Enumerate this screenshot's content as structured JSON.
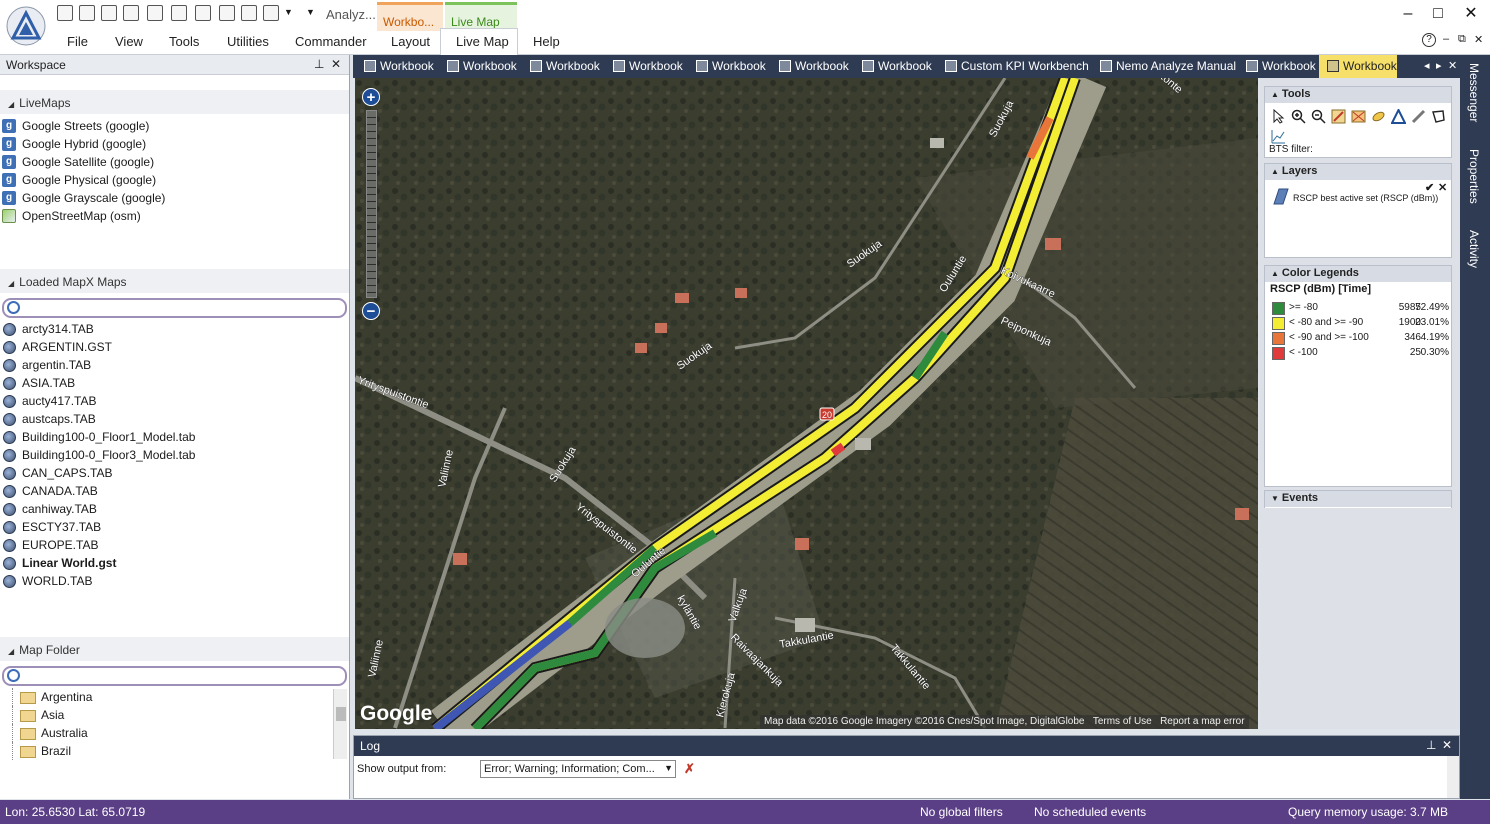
{
  "ribbon": {
    "search_label": "Analyz...",
    "context_tabs": [
      "Workbo...",
      "Live Map"
    ],
    "menu": [
      "File",
      "View",
      "Tools",
      "Utilities",
      "Commander",
      "Layout",
      "Live Map",
      "Help"
    ],
    "window_controls": [
      "–",
      "□",
      "✕"
    ],
    "help_icon": "?",
    "sub_controls": [
      "–",
      "⧉",
      "✕"
    ]
  },
  "workspace": {
    "title": "Workspace",
    "pin": "⊥",
    "close": "✕",
    "livemaps": {
      "heading": "LiveMaps",
      "items": [
        "Google Streets (google)",
        "Google Hybrid (google)",
        "Google Satellite (google)",
        "Google Physical (google)",
        "Google Grayscale (google)",
        "OpenStreetMap (osm)"
      ]
    },
    "mapx": {
      "heading": "Loaded MapX Maps",
      "items": [
        "arcty314.TAB",
        "ARGENTIN.GST",
        "argentin.TAB",
        "ASIA.TAB",
        "aucty417.TAB",
        "austcaps.TAB",
        "Building100-0_Floor1_Model.tab",
        "Building100-0_Floor3_Model.tab",
        "CAN_CAPS.TAB",
        "CANADA.TAB",
        "canhiway.TAB",
        "ESCTY37.TAB",
        "EUROPE.TAB",
        "Linear World.gst",
        "WORLD.TAB"
      ]
    },
    "folder": {
      "heading": "Map Folder",
      "items": [
        "Argentina",
        "Asia",
        "Australia",
        "Brazil"
      ]
    }
  },
  "tabs": [
    "Workbook",
    "Workbook",
    "Workbook",
    "Workbook",
    "Workbook",
    "Workbook",
    "Workbook",
    "Custom KPI Workbench",
    "Nemo Analyze Manual",
    "Workbook",
    "Workbook"
  ],
  "tab_nav": [
    "◂",
    "▸",
    "✕"
  ],
  "map": {
    "zoom_in": "+",
    "zoom_out": "−",
    "google_logo": "Google",
    "attribution": "Map data ©2016 Google Imagery ©2016 Cnes/Spot Image, DigitalGlobe",
    "terms": "Terms of Use",
    "report": "Report a map error",
    "route_marker": "20",
    "street_labels": [
      "Suokuja",
      "Suokuja",
      "Suokuja",
      "Suokuja",
      "Ouluntie",
      "Ouluntie",
      "Koivukaarre",
      "Peiponkuja",
      "Yrityspuistontie",
      "Yrityspuistontie",
      "Valiinne",
      "Valiinne",
      "Valkuja",
      "Takkulantie",
      "Takkulantie",
      "Raivaajankuja",
      "Kierokuja",
      "kyläntie",
      "tonte"
    ]
  },
  "rpanel": {
    "tools_heading": "Tools",
    "bts_filter": "BTS filter:",
    "layers_heading": "Layers",
    "layer_name": "RSCP best active set (RSCP (dBm))",
    "legend_heading": "Color Legends",
    "legend_title": "RSCP (dBm) [Time]",
    "legend": [
      {
        "label": ">= -80",
        "count": "5985",
        "pct": "72.49%",
        "color": "#2e8b3e"
      },
      {
        "label": "< -80 and >= -90",
        "count": "1900",
        "pct": "23.01%",
        "color": "#f3ee33"
      },
      {
        "label": "< -90 and >= -100",
        "count": "346",
        "pct": "4.19%",
        "color": "#e8763a"
      },
      {
        "label": "< -100",
        "count": "25",
        "pct": "0.30%",
        "color": "#e03a3a"
      }
    ],
    "events_heading": "Events"
  },
  "rstrip": [
    "Messenger",
    "Properties",
    "Activity"
  ],
  "log": {
    "title": "Log",
    "show_output": "Show output from:",
    "select_value": "Error; Warning; Information; Com...",
    "pin": "⊥",
    "close": "✕"
  },
  "status": {
    "coords": "Lon:  25.6530  Lat:  65.0719",
    "filters": "No global filters",
    "events": "No scheduled events",
    "memory": "Query memory usage: 3.7 MB"
  }
}
